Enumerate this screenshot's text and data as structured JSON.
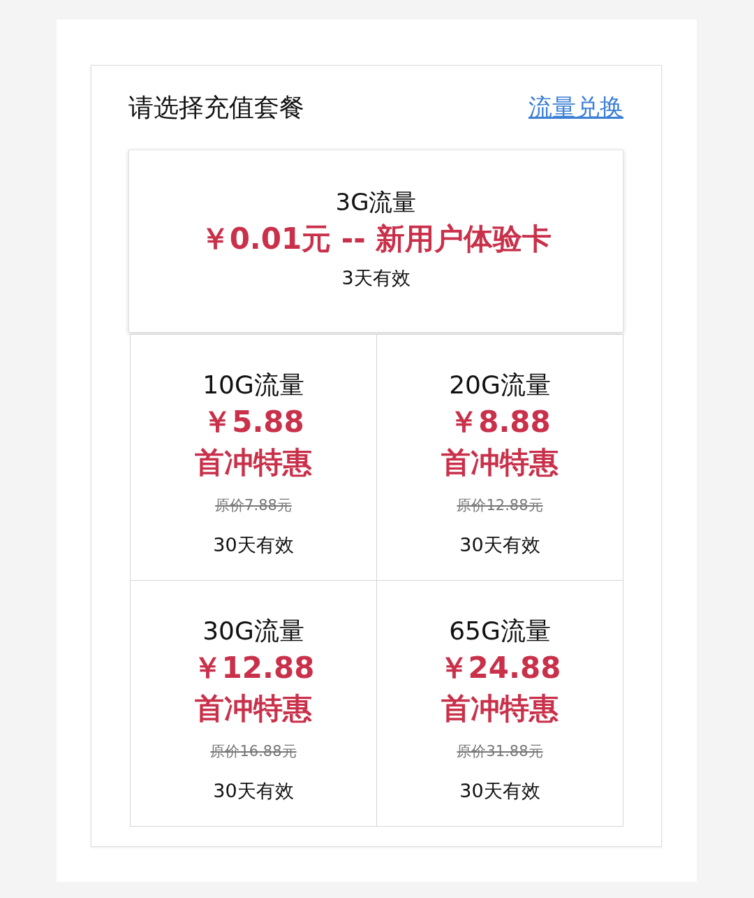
{
  "title": "请选择充值套餐",
  "link": "流量兑换",
  "featured": {
    "name": "3G流量",
    "price": "￥0.01元 -- 新用户体验卡",
    "validity": "3天有效",
    "selected": true
  },
  "plans": [
    {
      "name": "10G流量",
      "price": "￥5.88",
      "promo": "首冲特惠",
      "original_price": "原价7.88元",
      "validity": "30天有效",
      "selected": false
    },
    {
      "name": "20G流量",
      "price": "￥8.88",
      "promo": "首冲特惠",
      "original_price": "原价12.88元",
      "validity": "30天有效",
      "selected": false
    },
    {
      "name": "30G流量",
      "price": "￥12.88",
      "promo": "首冲特惠",
      "original_price": "原价16.88元",
      "validity": "30天有效",
      "selected": false
    },
    {
      "name": "65G流量",
      "price": "￥24.88",
      "promo": "首冲特惠",
      "original_price": "原价31.88元",
      "validity": "30天有效",
      "selected": false
    }
  ]
}
